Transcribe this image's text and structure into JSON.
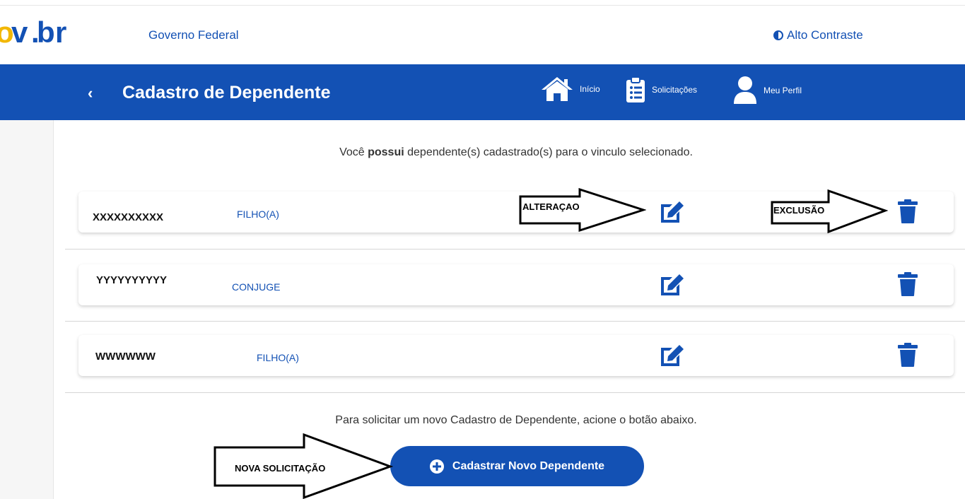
{
  "header": {
    "logo_text": "gov.br",
    "gov_label": "Governo Federal",
    "contrast_label": "Alto Contraste"
  },
  "navbar": {
    "back_symbol": "‹",
    "title": "Cadastro de Dependente",
    "items": [
      {
        "label": "Início",
        "icon": "home-icon"
      },
      {
        "label": "Solicitações",
        "icon": "clipboard-list-icon"
      },
      {
        "label": "Meu Perfil",
        "icon": "user-icon"
      }
    ]
  },
  "main": {
    "intro_prefix": "Você ",
    "intro_bold": "possui",
    "intro_suffix": " dependente(s) cadastrado(s) para o vinculo selecionado.",
    "dependents": [
      {
        "name": "XXXXXXXXXX",
        "relation": "FILHO(A)"
      },
      {
        "name": "YYYYYYYYYY",
        "relation": "CONJUGE"
      },
      {
        "name": "WWWWWW",
        "relation": "FILHO(A)"
      }
    ],
    "cta_text": "Para solicitar um novo Cadastro de Dependente, acione o botão abaixo.",
    "cta_button_label": "Cadastrar Novo Dependente"
  },
  "annotations": {
    "edit_label": "ALTERAÇAO",
    "delete_label": "EXCLUSÃO",
    "new_label": "NOVA SOLICITAÇÃO"
  },
  "colors": {
    "brand_blue": "#1351b4",
    "brand_yellow": "#f2b705"
  }
}
